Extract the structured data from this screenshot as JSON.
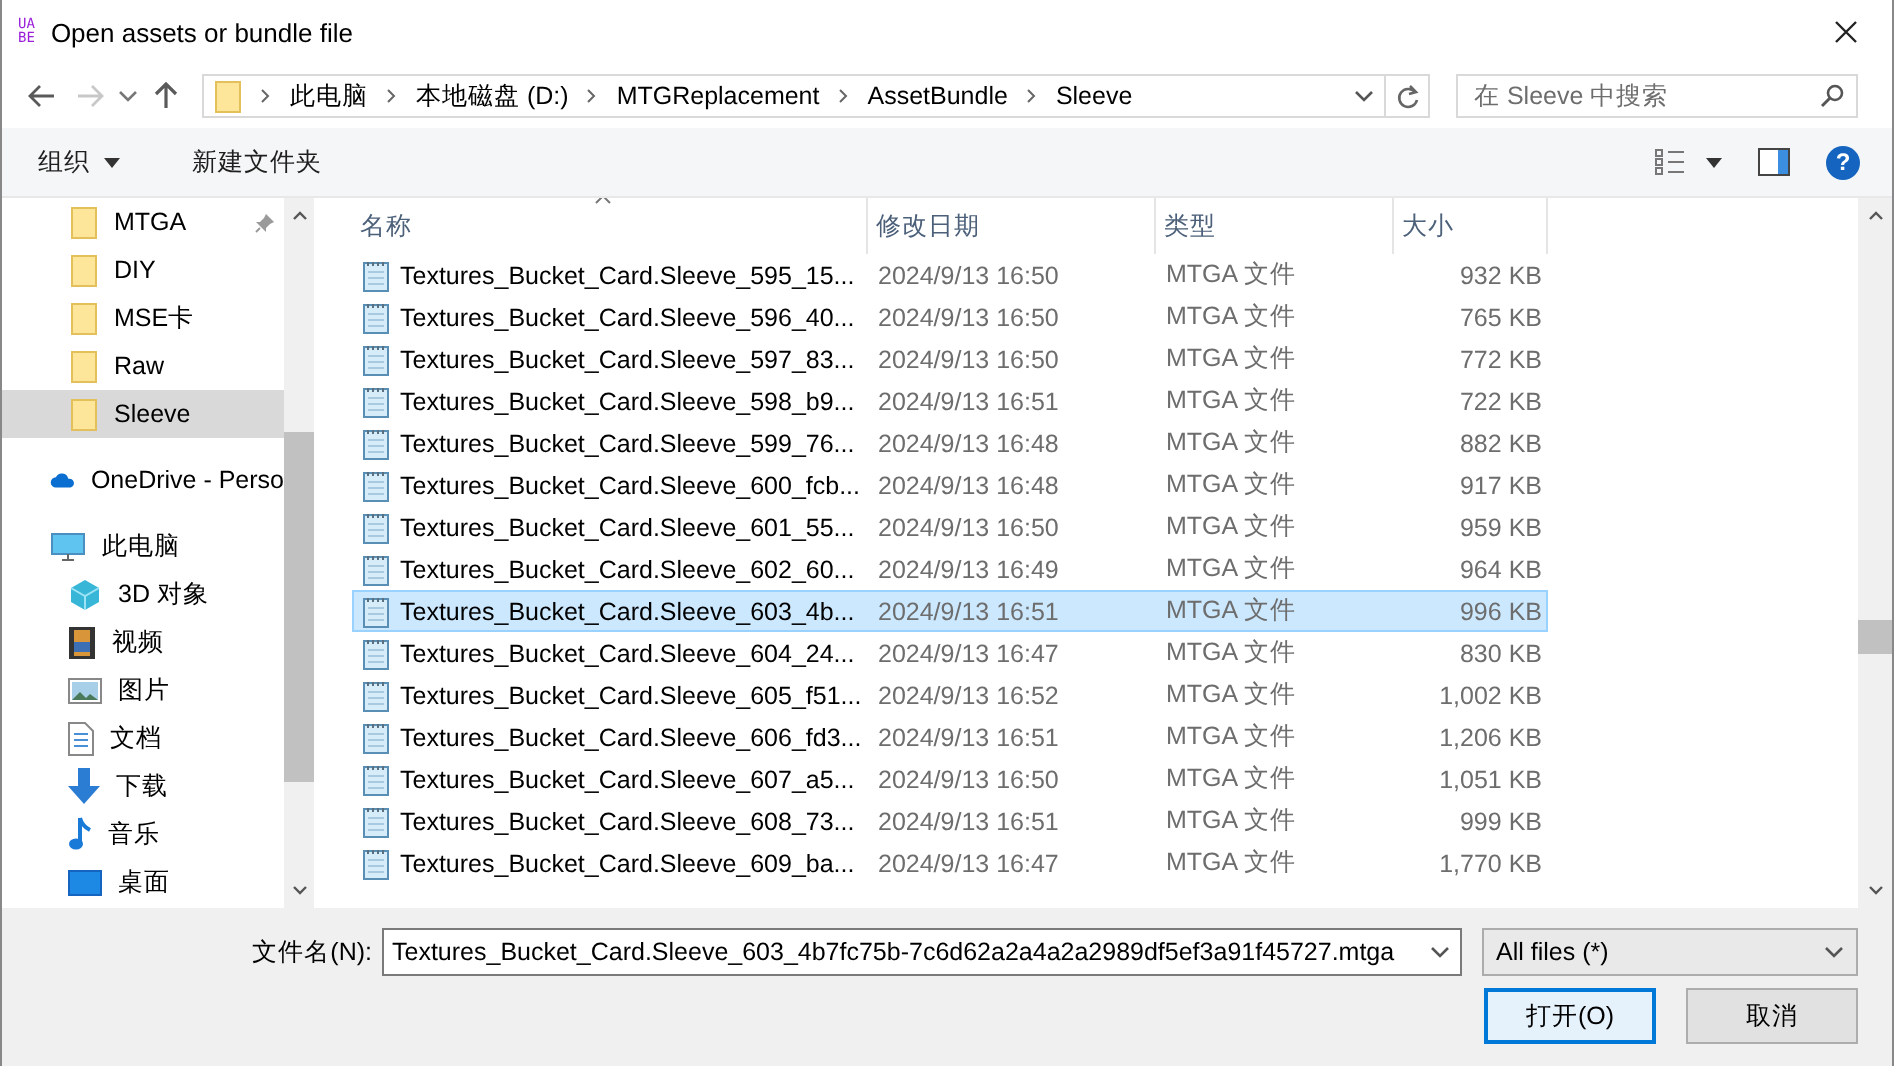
{
  "window": {
    "app_icon": [
      "UA",
      "BE"
    ],
    "title": "Open assets or bundle file"
  },
  "navigation": {
    "back": {
      "disabled": false
    },
    "forward": {
      "disabled": true
    },
    "up": {
      "disabled": false
    }
  },
  "address_bar": {
    "crumbs": [
      "此电脑",
      "本地磁盘 (D:)",
      "MTGReplacement",
      "AssetBundle",
      "Sleeve"
    ]
  },
  "search": {
    "placeholder": "在 Sleeve 中搜索"
  },
  "toolbar": {
    "organize": "组织",
    "new_folder": "新建文件夹",
    "help": "?"
  },
  "sidebar": {
    "items": [
      {
        "label": "MTGA",
        "kind": "folder",
        "pinned": true,
        "selected": false
      },
      {
        "label": "DIY",
        "kind": "folder",
        "pinned": false,
        "selected": false
      },
      {
        "label": "MSE卡",
        "kind": "folder",
        "pinned": false,
        "selected": false
      },
      {
        "label": "Raw",
        "kind": "folder",
        "pinned": false,
        "selected": false
      },
      {
        "label": "Sleeve",
        "kind": "folder",
        "pinned": false,
        "selected": true
      },
      {
        "label": "OneDrive - Perso",
        "kind": "cloud",
        "pinned": false,
        "selected": false
      },
      {
        "label": "此电脑",
        "kind": "computer",
        "pinned": false,
        "selected": false,
        "children": [
          {
            "label": "3D 对象",
            "kind": "cube",
            "pinned": false,
            "selected": false
          },
          {
            "label": "视频",
            "kind": "video",
            "pinned": false,
            "selected": false
          },
          {
            "label": "图片",
            "kind": "picture",
            "pinned": false,
            "selected": false
          },
          {
            "label": "文档",
            "kind": "document",
            "pinned": false,
            "selected": false
          },
          {
            "label": "下载",
            "kind": "download",
            "pinned": false,
            "selected": false
          },
          {
            "label": "音乐",
            "kind": "music",
            "pinned": false,
            "selected": false
          },
          {
            "label": "桌面",
            "kind": "desktop",
            "pinned": false,
            "selected": false
          }
        ]
      }
    ]
  },
  "table": {
    "columns": [
      "名称",
      "修改日期",
      "类型",
      "大小"
    ],
    "rows": [
      {
        "name": "Textures_Bucket_Card.Sleeve_595_15...",
        "modified": "2024/9/13 16:50",
        "type": "MTGA 文件",
        "size": "932 KB",
        "selected": false
      },
      {
        "name": "Textures_Bucket_Card.Sleeve_596_40...",
        "modified": "2024/9/13 16:50",
        "type": "MTGA 文件",
        "size": "765 KB",
        "selected": false
      },
      {
        "name": "Textures_Bucket_Card.Sleeve_597_83...",
        "modified": "2024/9/13 16:50",
        "type": "MTGA 文件",
        "size": "772 KB",
        "selected": false
      },
      {
        "name": "Textures_Bucket_Card.Sleeve_598_b9...",
        "modified": "2024/9/13 16:51",
        "type": "MTGA 文件",
        "size": "722 KB",
        "selected": false
      },
      {
        "name": "Textures_Bucket_Card.Sleeve_599_76...",
        "modified": "2024/9/13 16:48",
        "type": "MTGA 文件",
        "size": "882 KB",
        "selected": false
      },
      {
        "name": "Textures_Bucket_Card.Sleeve_600_fcb...",
        "modified": "2024/9/13 16:48",
        "type": "MTGA 文件",
        "size": "917 KB",
        "selected": false
      },
      {
        "name": "Textures_Bucket_Card.Sleeve_601_55...",
        "modified": "2024/9/13 16:50",
        "type": "MTGA 文件",
        "size": "959 KB",
        "selected": false
      },
      {
        "name": "Textures_Bucket_Card.Sleeve_602_60...",
        "modified": "2024/9/13 16:49",
        "type": "MTGA 文件",
        "size": "964 KB",
        "selected": false
      },
      {
        "name": "Textures_Bucket_Card.Sleeve_603_4b...",
        "modified": "2024/9/13 16:51",
        "type": "MTGA 文件",
        "size": "996 KB",
        "selected": true
      },
      {
        "name": "Textures_Bucket_Card.Sleeve_604_24...",
        "modified": "2024/9/13 16:47",
        "type": "MTGA 文件",
        "size": "830 KB",
        "selected": false
      },
      {
        "name": "Textures_Bucket_Card.Sleeve_605_f51...",
        "modified": "2024/9/13 16:52",
        "type": "MTGA 文件",
        "size": "1,002 KB",
        "selected": false
      },
      {
        "name": "Textures_Bucket_Card.Sleeve_606_fd3...",
        "modified": "2024/9/13 16:51",
        "type": "MTGA 文件",
        "size": "1,206 KB",
        "selected": false
      },
      {
        "name": "Textures_Bucket_Card.Sleeve_607_a5...",
        "modified": "2024/9/13 16:50",
        "type": "MTGA 文件",
        "size": "1,051 KB",
        "selected": false
      },
      {
        "name": "Textures_Bucket_Card.Sleeve_608_73...",
        "modified": "2024/9/13 16:51",
        "type": "MTGA 文件",
        "size": "999 KB",
        "selected": false
      },
      {
        "name": "Textures_Bucket_Card.Sleeve_609_ba...",
        "modified": "2024/9/13 16:47",
        "type": "MTGA 文件",
        "size": "1,770 KB",
        "selected": false
      }
    ]
  },
  "footer": {
    "filename_label": "文件名(N):",
    "filename": "Textures_Bucket_Card.Sleeve_603_4b7fc75b-7c6d62a2a4a2a2989df5ef3a91f45727.mtga",
    "filter": "All files (*)",
    "buttons": [
      {
        "label": "打开(O)",
        "default": true
      },
      {
        "label": "取消",
        "default": false
      }
    ]
  }
}
